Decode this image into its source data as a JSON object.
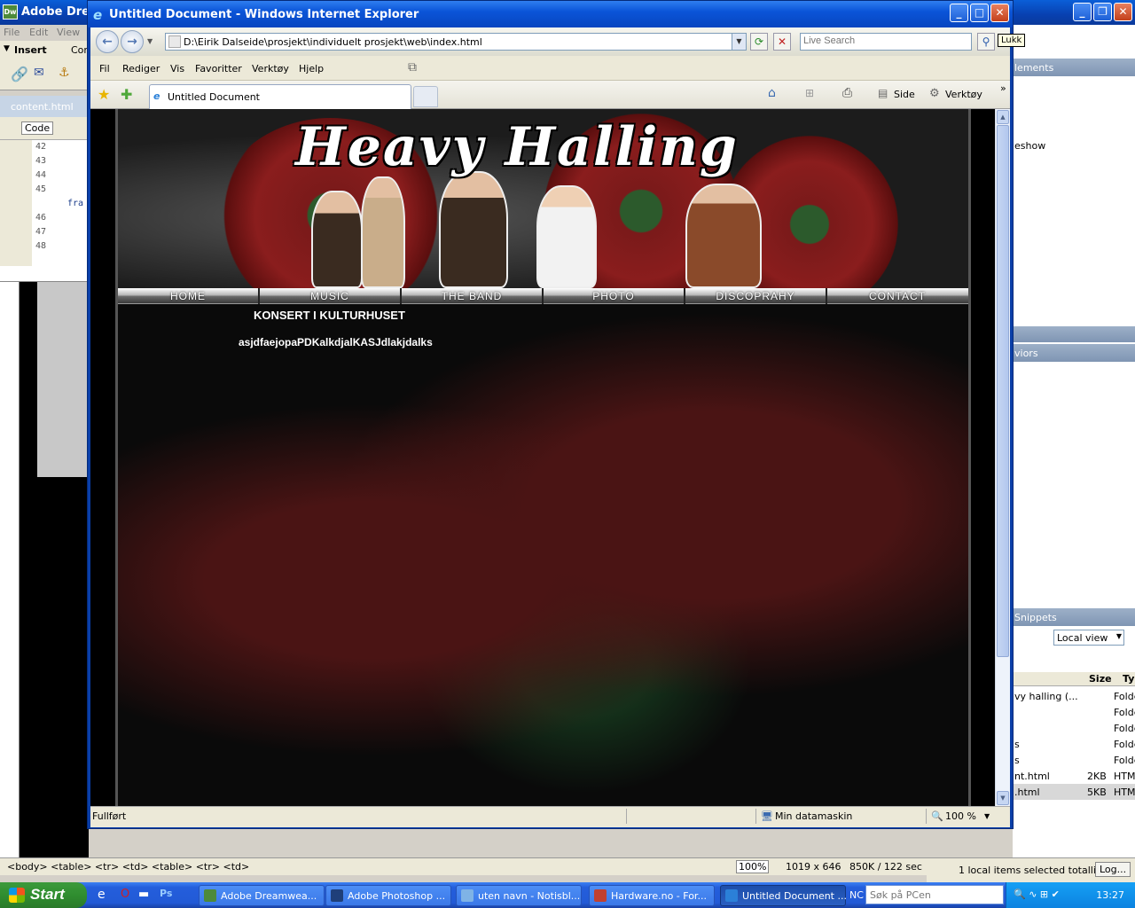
{
  "dreamweaver": {
    "title": "Adobe Dream",
    "menu": [
      "File",
      "Edit",
      "View"
    ],
    "insert_label": "Insert",
    "insert_tab": "Con",
    "tab": "content.html",
    "code_button": "Code",
    "line_numbers": [
      "42",
      "43",
      "44",
      "45",
      "46",
      "47",
      "48"
    ],
    "code_fragment": "fra",
    "status_tags": "<body> <table> <tr> <td> <table> <tr> <td>",
    "zoom": "100%",
    "dimensions": "1019 x 646",
    "filesize": "850K / 122 sec",
    "right_panel": {
      "elements_label": "lements",
      "slideshow_label": "eshow",
      "behaviors_label": "viors",
      "snippets_label": "Snippets",
      "local_view": "Local view",
      "col_size": "Size",
      "col_type": "Typ",
      "files": [
        {
          "name": "vy halling (...",
          "size": "",
          "type": "Folde"
        },
        {
          "name": "",
          "size": "",
          "type": "Folde"
        },
        {
          "name": "",
          "size": "",
          "type": "Folde"
        },
        {
          "name": "s",
          "size": "",
          "type": "Folde"
        },
        {
          "name": "s",
          "size": "",
          "type": "Folde"
        },
        {
          "name": "nt.html",
          "size": "2KB",
          "type": "HTML"
        },
        {
          "name": ".html",
          "size": "5KB",
          "type": "HTML"
        }
      ],
      "selection_status": "1 local items selected totalling",
      "log_button": "Log..."
    }
  },
  "ie": {
    "title": "Untitled Document - Windows Internet Explorer",
    "address": "D:\\Eirik Dalseide\\prosjekt\\individuelt prosjekt\\web\\index.html",
    "search_placeholder": "Live Search",
    "tooltip": "Lukk",
    "menu": [
      "Fil",
      "Rediger",
      "Vis",
      "Favoritter",
      "Verktøy",
      "Hjelp"
    ],
    "tab_title": "Untitled Document",
    "tools": {
      "page": "Side",
      "tools": "Verktøy"
    },
    "status_left": "Fullført",
    "status_zone": "Min datamaskin",
    "status_zoom": "100 %"
  },
  "site": {
    "logo": "Heavy Halling",
    "nav": [
      "HOME",
      "MUSIC",
      "THE BAND",
      "PHOTO",
      "DISCOPRAHY",
      "CONTACT"
    ],
    "heading": "KONSERT I KULTURHUSET",
    "body": "asjdfaejopaPDKalkdjalKASJdlakjdalks"
  },
  "taskbar": {
    "start": "Start",
    "buttons": [
      {
        "label": "Adobe Dreamwea...",
        "color": "#4d8a3a"
      },
      {
        "label": "Adobe Photoshop ...",
        "color": "#1f3f7a"
      },
      {
        "label": "uten navn - Notisbl...",
        "color": "#7fb3e6"
      },
      {
        "label": "Hardware.no - For...",
        "color": "#c04030"
      },
      {
        "label": "Untitled Document ...",
        "color": "#2b80d8"
      }
    ],
    "nc": "NC",
    "search_placeholder": "Søk på PCen",
    "clock": "13:27"
  },
  "colors": {
    "xp_blue": "#0a54d8",
    "start_green": "#2f8d2f",
    "banner_red": "#8a1d1d"
  }
}
